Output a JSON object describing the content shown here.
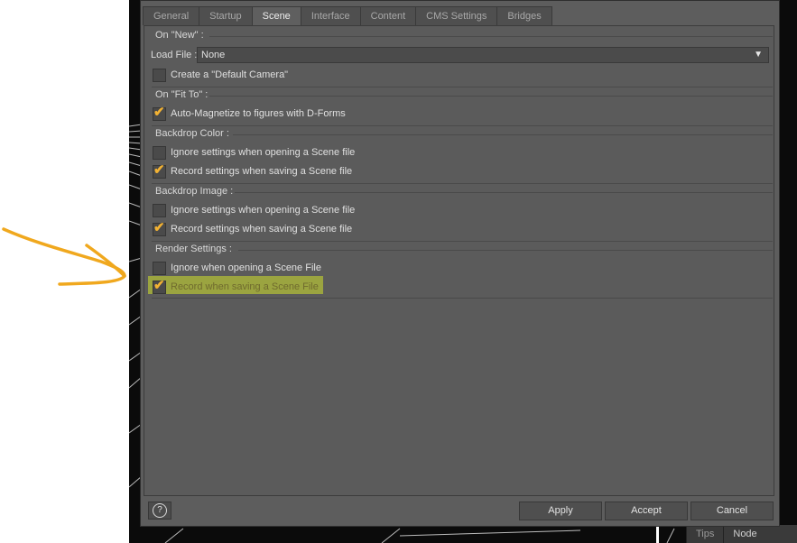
{
  "tabs": [
    {
      "label": "General"
    },
    {
      "label": "Startup"
    },
    {
      "label": "Scene"
    },
    {
      "label": "Interface"
    },
    {
      "label": "Content"
    },
    {
      "label": "CMS Settings"
    },
    {
      "label": "Bridges"
    }
  ],
  "active_tab": "Scene",
  "sections": {
    "on_new": {
      "label": "On \"New\" :",
      "load_file_label": "Load File :",
      "load_file_value": "None",
      "create_default_camera": {
        "label": "Create a \"Default Camera\"",
        "checked": false
      }
    },
    "on_fit_to": {
      "label": "On \"Fit To\" :",
      "auto_magnetize": {
        "label": "Auto-Magnetize to figures with D-Forms",
        "checked": true
      }
    },
    "backdrop_color": {
      "label": "Backdrop Color :",
      "ignore": {
        "label": "Ignore settings when opening a Scene file",
        "checked": false
      },
      "record": {
        "label": "Record settings when saving a Scene file",
        "checked": true
      }
    },
    "backdrop_image": {
      "label": "Backdrop Image :",
      "ignore": {
        "label": "Ignore settings when opening a Scene file",
        "checked": false
      },
      "record": {
        "label": "Record settings when saving a Scene file",
        "checked": true
      }
    },
    "render_settings": {
      "label": "Render Settings :",
      "ignore": {
        "label": "Ignore when opening a Scene File",
        "checked": false
      },
      "record": {
        "label": "Record when saving a Scene File",
        "checked": true
      }
    }
  },
  "footer": {
    "help_icon": "?",
    "apply_label": "Apply",
    "accept_label": "Accept",
    "cancel_label": "Cancel"
  },
  "status_bar": {
    "tips_label": "Tips",
    "node_label": "Node"
  },
  "colors": {
    "accent_check": "#f2b233",
    "annotation_arrow": "#f0a81e",
    "highlight": "#d9e22a"
  }
}
